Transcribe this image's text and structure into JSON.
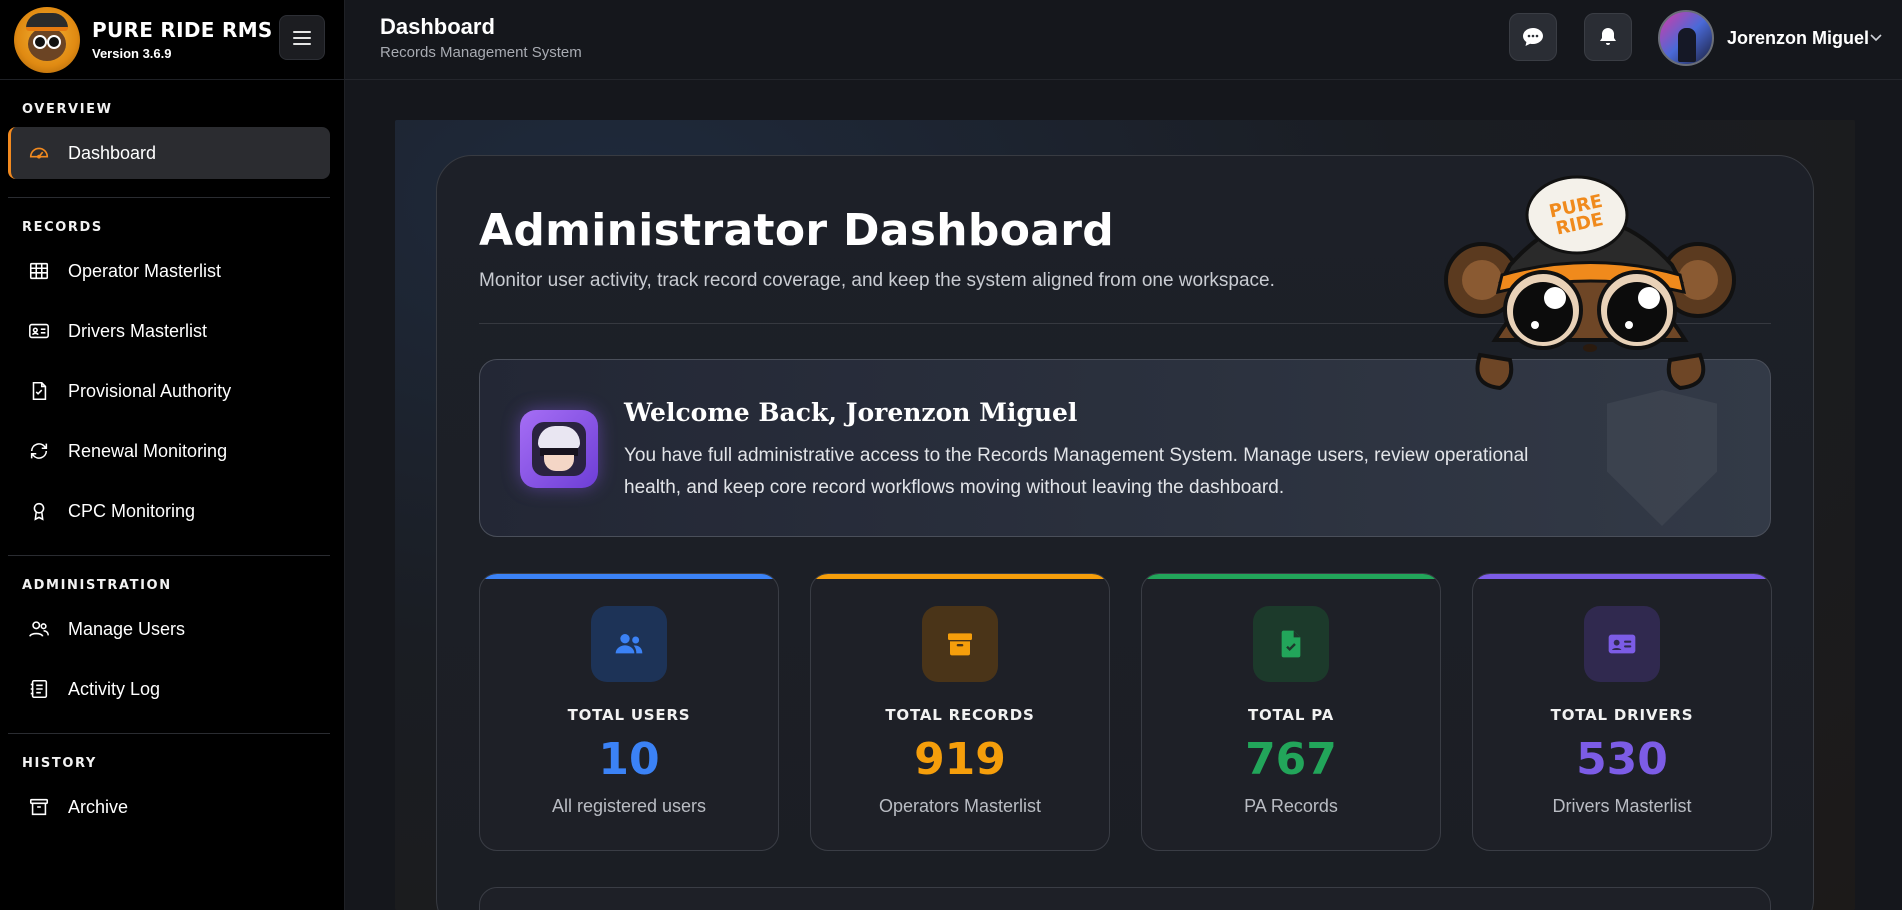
{
  "brand": {
    "name": "PURE RIDE RMS",
    "version": "Version 3.6.9"
  },
  "header": {
    "title": "Dashboard",
    "subtitle": "Records Management System",
    "user_name": "Jorenzon Miguel"
  },
  "sidebar": {
    "sections": [
      {
        "title": "OVERVIEW",
        "items": [
          {
            "label": "Dashboard",
            "icon": "gauge-icon",
            "active": true
          }
        ]
      },
      {
        "title": "RECORDS",
        "items": [
          {
            "label": "Operator Masterlist",
            "icon": "table-icon"
          },
          {
            "label": "Drivers Masterlist",
            "icon": "id-card-icon"
          },
          {
            "label": "Provisional Authority",
            "icon": "file-check-icon"
          },
          {
            "label": "Renewal Monitoring",
            "icon": "refresh-icon"
          },
          {
            "label": "CPC Monitoring",
            "icon": "award-icon"
          }
        ]
      },
      {
        "title": "ADMINISTRATION",
        "items": [
          {
            "label": "Manage Users",
            "icon": "users-icon"
          },
          {
            "label": "Activity Log",
            "icon": "log-icon"
          }
        ]
      },
      {
        "title": "HISTORY",
        "items": [
          {
            "label": "Archive",
            "icon": "archive-icon"
          }
        ]
      }
    ]
  },
  "main": {
    "title": "Administrator Dashboard",
    "subtitle": "Monitor user activity, track record coverage, and keep the system aligned from one workspace.",
    "welcome": {
      "title": "Welcome Back, Jorenzon Miguel",
      "text": "You have full administrative access to the Records Management System. Manage users, review operational health, and keep core record workflows moving without leaving the dashboard."
    },
    "mascot_cap_text": "PURE RIDE",
    "stats": [
      {
        "label": "TOTAL USERS",
        "value": "10",
        "desc": "All registered users",
        "color": "#3b82f6",
        "icon": "users-icon"
      },
      {
        "label": "TOTAL RECORDS",
        "value": "919",
        "desc": "Operators Masterlist",
        "color": "#f59e0b",
        "icon": "archive-box-icon"
      },
      {
        "label": "TOTAL PA",
        "value": "767",
        "desc": "PA Records",
        "color": "#22a55a",
        "icon": "document-check-icon"
      },
      {
        "label": "TOTAL DRIVERS",
        "value": "530",
        "desc": "Drivers Masterlist",
        "color": "#7c5ce6",
        "icon": "id-card-icon"
      }
    ]
  },
  "colors": {
    "accent": "#f28a1f",
    "sidebar_bg": "#000000",
    "page_bg": "#15171c"
  }
}
